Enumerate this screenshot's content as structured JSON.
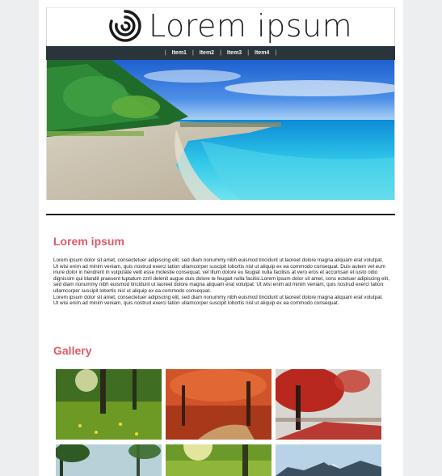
{
  "header": {
    "logo_text": "Lorem  ipsum",
    "logo_icon": "spiral-logo-icon"
  },
  "nav": {
    "items": [
      "Item1",
      "Item2",
      "Item3",
      "Item4"
    ],
    "separator": "|"
  },
  "hero": {
    "image": "tropical-beach-photo"
  },
  "article": {
    "title": "Lorem ipsum",
    "paragraphs": [
      "Lorem ipsum dolor sit amet, consectetuer adipiscing elit, sed diam nonummy nibh euismod tincidunt ut laoreet dolore magna aliquam erat volutpat. Ut wisi enim ad minim veniam, quis nostrud exerci tation ullamcorper suscipit lobortis nisl ut aliquip ex ea commodo consequat. Duis autem vel eum iriure dolor in hendrerit in vulputate velit esse molestie consequat, vel illum dolore eu feugiat nulla facilisis at vero eros et accumsan et iusto odio dignissim qui blandit praesent luptatum zzril delenit augue duis dolore te feugait nulla facilisi.Lorem ipsum dolor sit amet, cons ectetuer adipiscing elit, sed diam nonummy nibh euismod tincidunt ut laoreet dolore magna aliquam erat volutpat. Ut wisi enim ad minim veniam, quis nostrud exerci tation ullamcorper suscipit lobortis nisl ut aliquip ex ea commodo consequat.",
      "Lorem ipsum dolor sit amet, consectetuer adipiscing elit, sed diam nonummy nibh euismod tincidunt ut laoreet dolore magna aliquam erat volutpat. Ut wisi enim ad minim veniam, quis nostrud exerci tation ullamcorper suscipit lobortis nisl ut aliquip ex ea commodo consequat."
    ]
  },
  "gallery": {
    "title": "Gallery",
    "images": [
      "grassy-forest-meadow-photo",
      "red-autumn-forest-path-photo",
      "red-tree-misty-road-photo",
      "palm-beach-photo",
      "sunlit-forest-photo",
      "mountain-sky-photo"
    ]
  },
  "colors": {
    "accent": "#e05a66",
    "nav_bg": "#2a343b",
    "page_bg": "#eceeef"
  }
}
